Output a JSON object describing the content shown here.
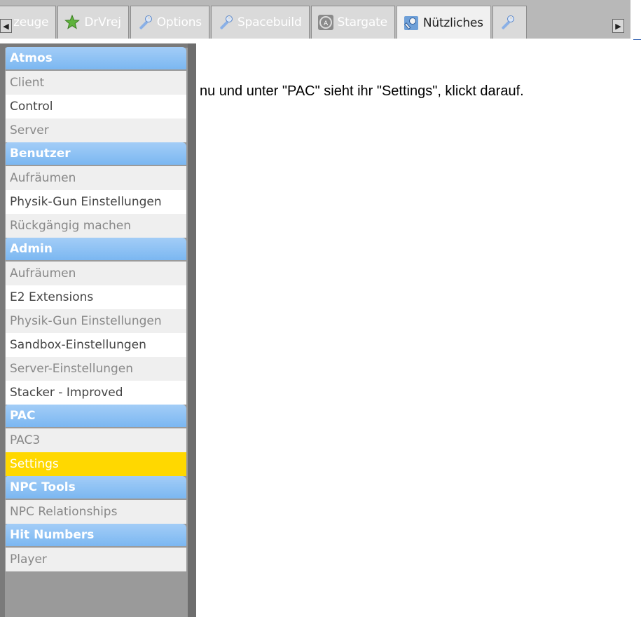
{
  "tabs": [
    {
      "label": "zeuge",
      "icon": "tool-icon",
      "active": false
    },
    {
      "label": "DrVrej",
      "icon": "star-icon",
      "active": false
    },
    {
      "label": "Options",
      "icon": "wrench-icon",
      "active": false
    },
    {
      "label": "Spacebuild",
      "icon": "wrench-icon",
      "active": false
    },
    {
      "label": "Stargate",
      "icon": "stargate-icon",
      "active": false
    },
    {
      "label": "Nützliches",
      "icon": "wrench-key-icon",
      "active": true
    },
    {
      "label": "",
      "icon": "wrench-icon",
      "active": false
    }
  ],
  "scroll": {
    "left_glyph": "◀",
    "right_glyph": "▶"
  },
  "categories": [
    {
      "header": "Atmos",
      "items": [
        "Client",
        "Control",
        "Server"
      ]
    },
    {
      "header": "Benutzer",
      "items": [
        "Aufräumen",
        "Physik-Gun Einstellungen",
        "Rückgängig machen"
      ]
    },
    {
      "header": "Admin",
      "items": [
        "Aufräumen",
        "E2 Extensions",
        "Physik-Gun Einstellungen",
        "Sandbox-Einstellungen",
        "Server-Einstellungen",
        "Stacker - Improved"
      ]
    },
    {
      "header": "PAC",
      "items": [
        "PAC3",
        "Settings"
      ]
    },
    {
      "header": "NPC Tools",
      "items": [
        "NPC Relationships"
      ]
    },
    {
      "header": "Hit Numbers",
      "items": [
        "Player"
      ]
    }
  ],
  "selected_item": "Settings",
  "overlay_text": "nu und unter \"PAC\" sieht ihr \"Settings\", klickt darauf.",
  "colors": {
    "header_blue": "#7bb7f1",
    "selected_yellow": "#ffd800",
    "tab_gray": "#dadada"
  }
}
